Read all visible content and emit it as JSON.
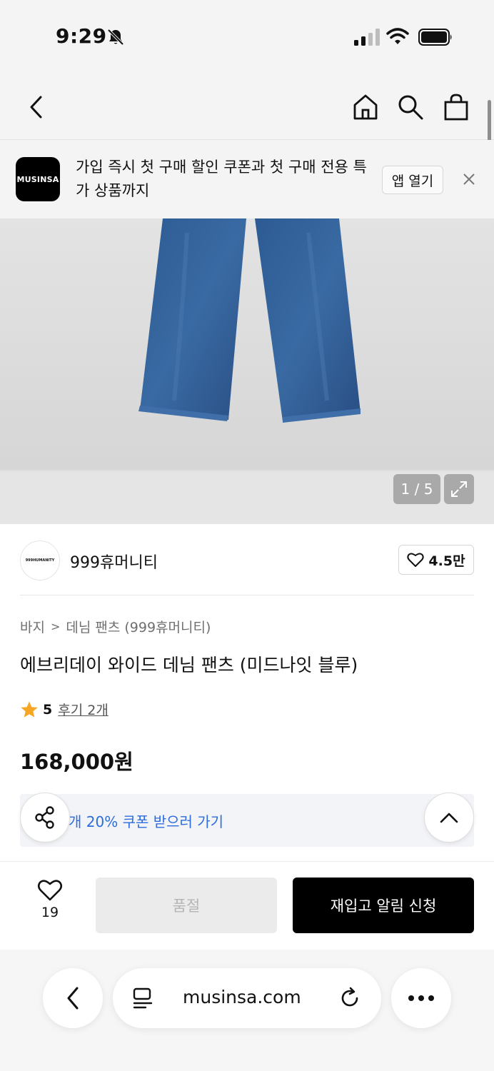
{
  "status_bar": {
    "time": "9:29"
  },
  "banner": {
    "logo_text": "MUSINSA",
    "text": "가입 즉시 첫 구매 할인 쿠폰과 첫 구매 전용 특가 상품까지",
    "open_app_label": "앱 열기"
  },
  "gallery": {
    "counter": "1 / 5"
  },
  "brand": {
    "logo_text": "999HUMANITY",
    "name": "999휴머니티",
    "likes": "4.5만"
  },
  "breadcrumb": {
    "category": "바지",
    "separator": ">",
    "subcategory": "데님 팬츠 (999휴머니티)"
  },
  "product": {
    "title": "에브리데이 와이드 데님 팬츠 (미드나잇 블루)",
    "rating": "5",
    "review_link": "후기 2개",
    "price": "168,000원",
    "coupon_text": "개 20% 쿠폰 받으러 가기"
  },
  "purchase_bar": {
    "wish_count": "19",
    "soldout_label": "품절",
    "restock_label": "재입고 알림 신청"
  },
  "browser": {
    "url": "musinsa.com"
  },
  "colors": {
    "accent_blue": "#2d6cdf",
    "star": "#f5a623",
    "primary_button": "#000000",
    "disabled_button": "#ebebeb"
  }
}
